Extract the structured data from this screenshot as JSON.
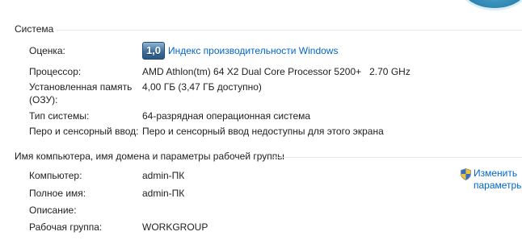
{
  "system": {
    "heading": "Система",
    "rating": {
      "label": "Оценка:",
      "score": "1,0",
      "link": "Индекс производительности Windows"
    },
    "processor": {
      "label": "Процессор:",
      "value": "AMD Athlon(tm) 64 X2 Dual Core Processor 5200+   2.70 GHz"
    },
    "memory": {
      "label_line1": "Установленная память",
      "label_line2": "(ОЗУ):",
      "value": "4,00 ГБ (3,47 ГБ доступно)"
    },
    "system_type": {
      "label": "Тип системы:",
      "value": "64-разрядная операционная система"
    },
    "pen_touch": {
      "label": "Перо и сенсорный ввод:",
      "value": "Перо и сенсорный ввод недоступны для этого экрана"
    }
  },
  "computer_name": {
    "heading": "Имя компьютера, имя домена и параметры рабочей группы",
    "computer": {
      "label": "Компьютер:",
      "value": "admin-ПК"
    },
    "full_name": {
      "label": "Полное имя:",
      "value": "admin-ПК"
    },
    "description": {
      "label": "Описание:",
      "value": ""
    },
    "workgroup": {
      "label": "Рабочая группа:",
      "value": "WORKGROUP"
    },
    "change_link": {
      "line1": "Изменить",
      "line2": "параметры",
      "icon": "uac-shield-icon"
    }
  },
  "colors": {
    "link": "#0066cc",
    "text": "#1e1e1e",
    "divider": "#e3e7ec"
  }
}
